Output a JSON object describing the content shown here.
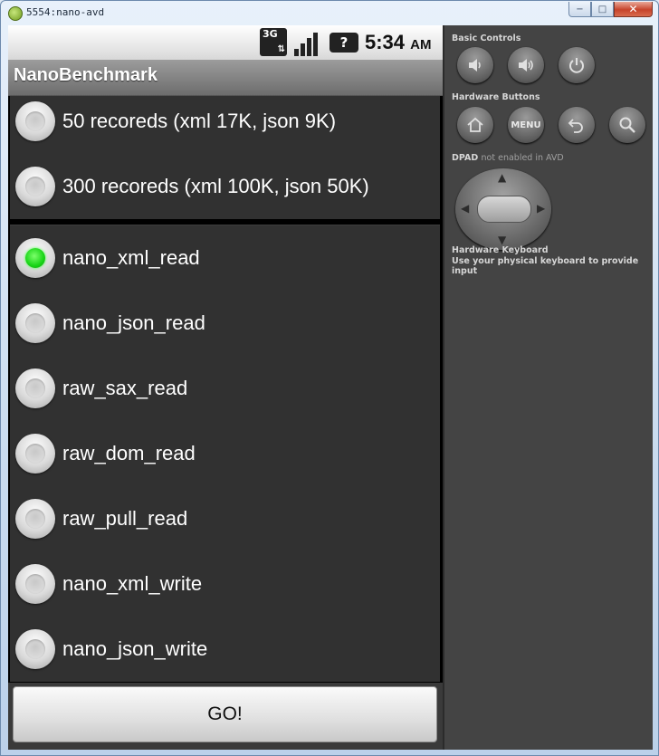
{
  "window": {
    "title": "5554:nano-avd",
    "minimize_glyph": "−",
    "maximize_glyph": "□",
    "close_glyph": "✕"
  },
  "statusbar": {
    "network": "3G",
    "network_arrows": "⇅",
    "unknown_glyph": "?",
    "time": "5:34",
    "ampm": "AM"
  },
  "app": {
    "title": "NanoBenchmark"
  },
  "record_options": [
    {
      "label": "50 recoreds (xml 17K, json 9K)",
      "checked": false
    },
    {
      "label": "300 recoreds (xml 100K, json 50K)",
      "checked": false
    }
  ],
  "method_options": [
    {
      "label": "nano_xml_read",
      "checked": true
    },
    {
      "label": "nano_json_read",
      "checked": false
    },
    {
      "label": "raw_sax_read",
      "checked": false
    },
    {
      "label": "raw_dom_read",
      "checked": false
    },
    {
      "label": "raw_pull_read",
      "checked": false
    },
    {
      "label": "nano_xml_write",
      "checked": false
    },
    {
      "label": "nano_json_write",
      "checked": false
    }
  ],
  "go_button": {
    "label": "GO!"
  },
  "panel": {
    "basic_controls": "Basic Controls",
    "hardware_buttons": "Hardware Buttons",
    "menu_label": "MENU",
    "dpad_label": "DPAD",
    "dpad_note": "not enabled in AVD",
    "keyboard_label": "Hardware Keyboard",
    "keyboard_note": "Use your physical keyboard to provide input"
  },
  "colors": {
    "radio_checked": "#18d416",
    "list_background": "#313131",
    "panel_background": "#444444"
  }
}
